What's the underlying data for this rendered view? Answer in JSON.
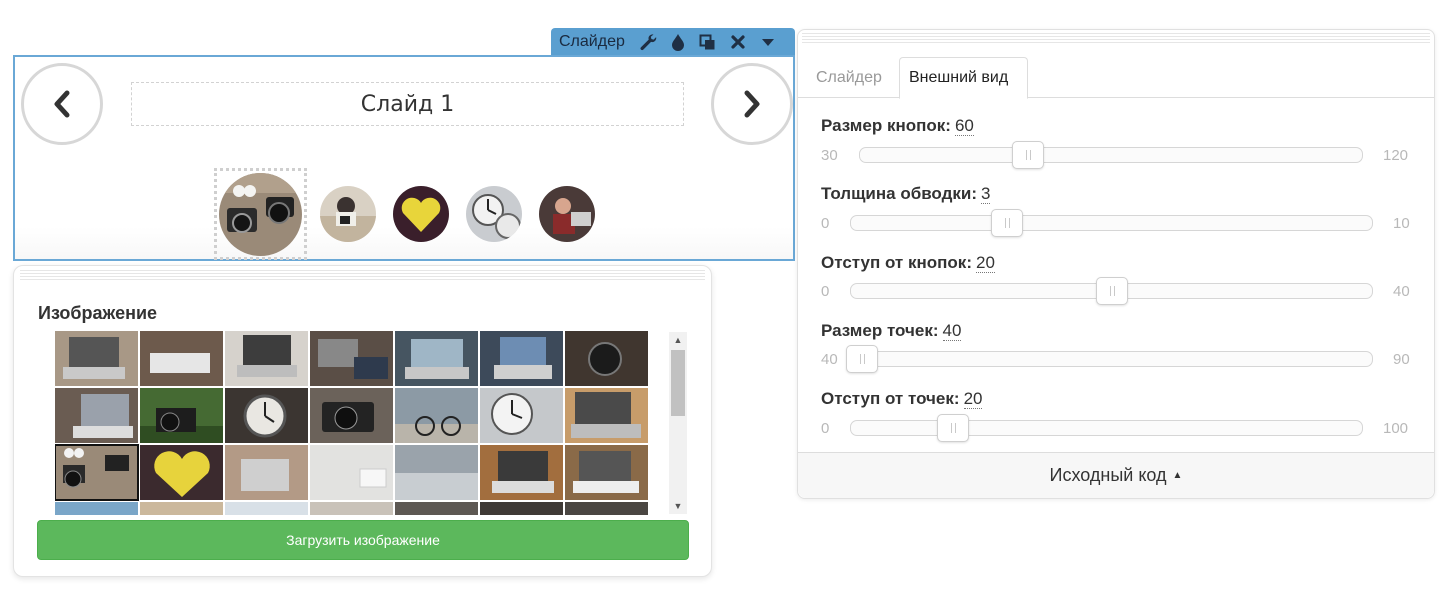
{
  "toolbar": {
    "title": "Слайдер",
    "buttons": [
      {
        "icon": "wrench-icon"
      },
      {
        "icon": "droplet-icon"
      },
      {
        "icon": "copy-icon"
      },
      {
        "icon": "close-icon"
      },
      {
        "icon": "caret-down-icon"
      }
    ]
  },
  "slider": {
    "slide_caption": "Слайд 1",
    "prev_icon": "chevron-left-icon",
    "next_icon": "chevron-right-icon",
    "dots": [
      "camera-on-desk",
      "person-with-camera",
      "yellow-heart",
      "clock",
      "person-at-laptop"
    ],
    "active_dot": 0
  },
  "image_panel": {
    "title": "Изображение",
    "thumbnails": [
      "laptop",
      "keyboard",
      "laptop",
      "laptop-hands",
      "laptop",
      "laptop",
      "camera",
      "laptop-table",
      "camera-grass",
      "watch",
      "camera",
      "bike",
      "clock",
      "laptop-hands",
      "camera-desk",
      "yellow-heart",
      "macbook",
      "white-room",
      "blurred",
      "laptop",
      "laptop-white"
    ],
    "selected_index": 14,
    "upload_button": "Загрузить изображение"
  },
  "settings": {
    "tabs": [
      {
        "label": "Слайдер",
        "active": false
      },
      {
        "label": "Внешний вид",
        "active": true
      }
    ],
    "sliders": [
      {
        "label": "Размер кнопок",
        "value": "60",
        "min": "30",
        "max": "120",
        "fraction": 0.333
      },
      {
        "label": "Толщина обводки",
        "value": "3",
        "min": "0",
        "max": "10",
        "fraction": 0.3
      },
      {
        "label": "Отступ от кнопок",
        "value": "20",
        "min": "0",
        "max": "40",
        "fraction": 0.5
      },
      {
        "label": "Размер точек",
        "value": "40",
        "min": "40",
        "max": "90",
        "fraction": 0.0
      },
      {
        "label": "Отступ от точек",
        "value": "20",
        "min": "0",
        "max": "100",
        "fraction": 0.2
      }
    ],
    "source_code": "Исходный код"
  },
  "colors": {
    "toolbar_bg": "#5a9fd0",
    "selection_border": "#6aa8d6",
    "upload_button": "#5cb85c"
  }
}
